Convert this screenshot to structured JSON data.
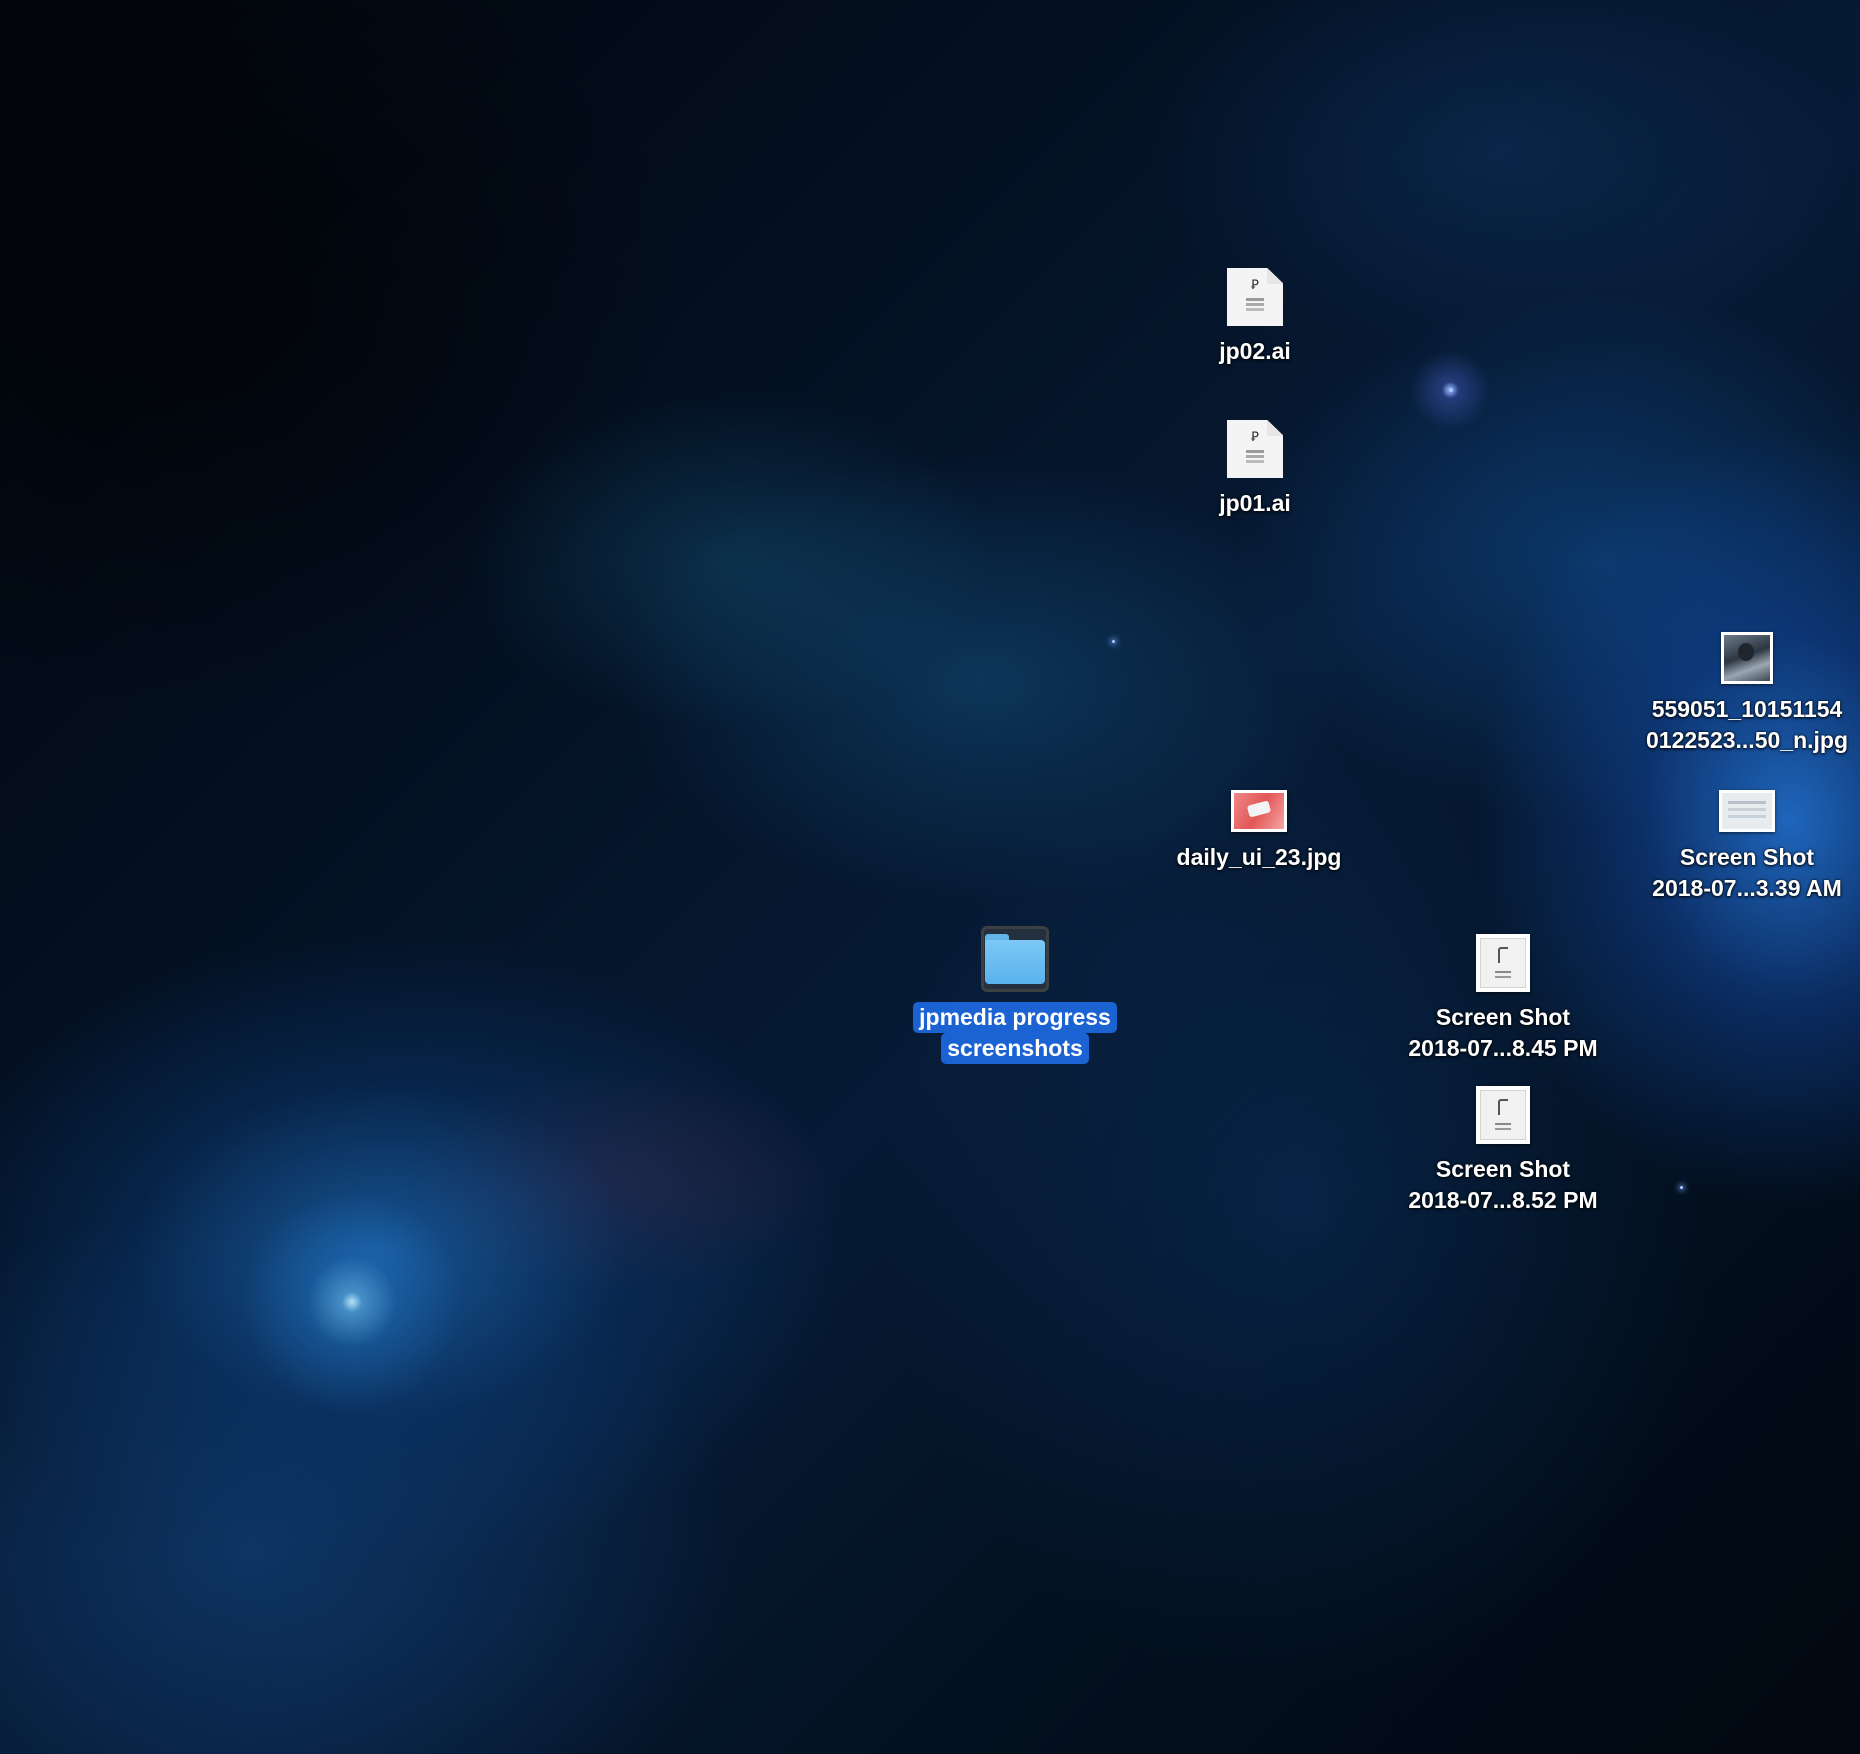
{
  "desktop": {
    "icons": [
      {
        "id": "jp02",
        "lines": [
          "jp02.ai"
        ],
        "kind": "illustrator-document"
      },
      {
        "id": "jp01",
        "lines": [
          "jp01.ai"
        ],
        "kind": "illustrator-document"
      },
      {
        "id": "photo",
        "lines": [
          "559051_10151154",
          "0122523...50_n.jpg"
        ],
        "kind": "photo"
      },
      {
        "id": "daily",
        "lines": [
          "daily_ui_23.jpg"
        ],
        "kind": "image"
      },
      {
        "id": "shot339",
        "lines": [
          "Screen Shot",
          "2018-07...3.39 AM"
        ],
        "kind": "screenshot"
      },
      {
        "id": "folder",
        "lines": [
          "jpmedia progress",
          "screenshots"
        ],
        "kind": "folder",
        "selected": true
      },
      {
        "id": "shot845",
        "lines": [
          "Screen Shot",
          "2018-07...8.45 PM"
        ],
        "kind": "screenshot"
      },
      {
        "id": "shot852",
        "lines": [
          "Screen Shot",
          "2018-07...8.52 PM"
        ],
        "kind": "screenshot"
      }
    ]
  },
  "colors": {
    "selection": "#1b63d2",
    "folder": "#5ab2ec",
    "label_text": "#ffffff"
  }
}
